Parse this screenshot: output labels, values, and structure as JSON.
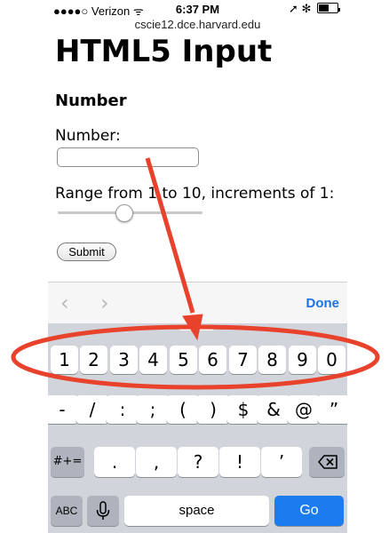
{
  "status_bar": {
    "signal": "●●●●○",
    "carrier": "Verizon",
    "wifi": "ᯤ",
    "time": "6:37 PM",
    "location": "➚",
    "bluetooth": "✻"
  },
  "browser": {
    "url": "cscie12.dce.harvard.edu"
  },
  "page": {
    "title": "HTML5 Input",
    "section_heading": "Number",
    "number_label": "Number:",
    "number_value": "",
    "range_label": "Range from 1 to 10, increments of 1:",
    "range": {
      "min": 1,
      "max": 10,
      "step": 1,
      "value": 5
    },
    "submit_label": "Submit"
  },
  "keyboard_accessory": {
    "prev_icon": "chevron-left-icon",
    "next_icon": "chevron-right-icon",
    "done_label": "Done"
  },
  "keyboard": {
    "number_row": [
      "1",
      "2",
      "3",
      "4",
      "5",
      "6",
      "7",
      "8",
      "9",
      "0"
    ],
    "symbol_row": [
      "-",
      "/",
      ":",
      ";",
      "(",
      ")",
      "$",
      "&",
      "@",
      "”"
    ],
    "toggle_label": "#+=",
    "punct_row": [
      ".",
      ",",
      "?",
      "!",
      "’"
    ],
    "delete_icon": "backspace-icon",
    "abc_label": "ABC",
    "mic_icon": "microphone-icon",
    "space_label": "space",
    "go_label": "Go"
  },
  "colors": {
    "annotation": "#e8422c",
    "accent": "#1b7cf0",
    "done": "#1a73e8"
  }
}
